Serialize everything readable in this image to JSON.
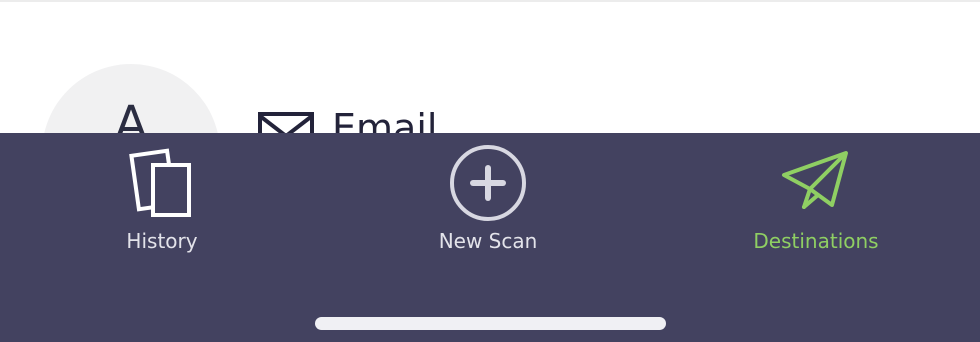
{
  "content": {
    "avatar_letter": "A",
    "destination_label": "Email"
  },
  "tabs": {
    "history": {
      "label": "History",
      "icon": "documents-icon"
    },
    "new_scan": {
      "label": "New Scan",
      "icon": "plus-circle-icon"
    },
    "destinations": {
      "label": "Destinations",
      "icon": "paper-plane-icon",
      "active": true
    }
  },
  "colors": {
    "tabbar_bg": "#434260",
    "active": "#8fcf63",
    "inactive": "#e3e3ea"
  }
}
